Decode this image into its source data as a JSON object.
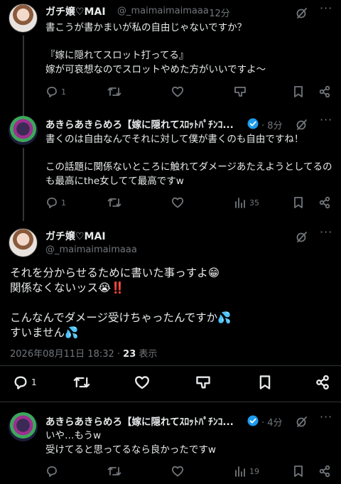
{
  "tweet1": {
    "name": "ガチ嬢♡MAI",
    "handle": "@_maimaimaimaaa",
    "time": "· 12分",
    "text": "書こうが書かまいが私の自由じゃないですか？\n\n『嫁に隠れてスロット打ってる』\n嫁が可哀想なのでスロットやめた方がいいですよ〜",
    "reply_count": "1",
    "views": ""
  },
  "tweet2": {
    "name": "あきらあきらめろ【嫁に隠れてｽﾛｯﾄﾊﾟﾁﾝｺ...",
    "time": "· 8分",
    "text": "書くのは自由なんでそれに対して僕が書くのも自由ですね！\n\nこの話題に関係ないところに触れてダメージあたえようとしてるのも最高にthe女してて最高ですw",
    "reply_count": "1",
    "views": "35"
  },
  "main": {
    "name": "ガチ嬢♡MAI",
    "handle": "@_maimaimaimaaa",
    "text": "それを分からせるために書いた事っすよ😁\n関係なくないッス😭‼️\n\nこんなんでダメージ受けちゃったんですか💦\nすいません💦",
    "timestamp": "2026年08月11日 18:32",
    "views_sep": " · ",
    "views": "23",
    "views_label": " 表示",
    "reply_count": "1"
  },
  "tweet3": {
    "name": "あきらあきらめろ【嫁に隠れてｽﾛｯﾄﾊﾟﾁﾝｺ...",
    "time": "· 4分",
    "text": "いや…もうw\n受けてると思ってるなら良かったですw",
    "reply_count": "",
    "views": "19"
  },
  "icons": {
    "reply": "reply-icon",
    "retweet": "retweet-icon",
    "like": "heart-icon",
    "dislike": "downvote-icon",
    "bookmark": "bookmark-icon",
    "share": "share-icon",
    "grok": "grok-icon",
    "more": "more-icon",
    "verified": "verified-badge-icon"
  },
  "colors": {
    "background": "#000000",
    "text": "#e7e9ea",
    "muted": "#71767b",
    "verified": "#1d9bf0",
    "divider": "#2f3336"
  }
}
